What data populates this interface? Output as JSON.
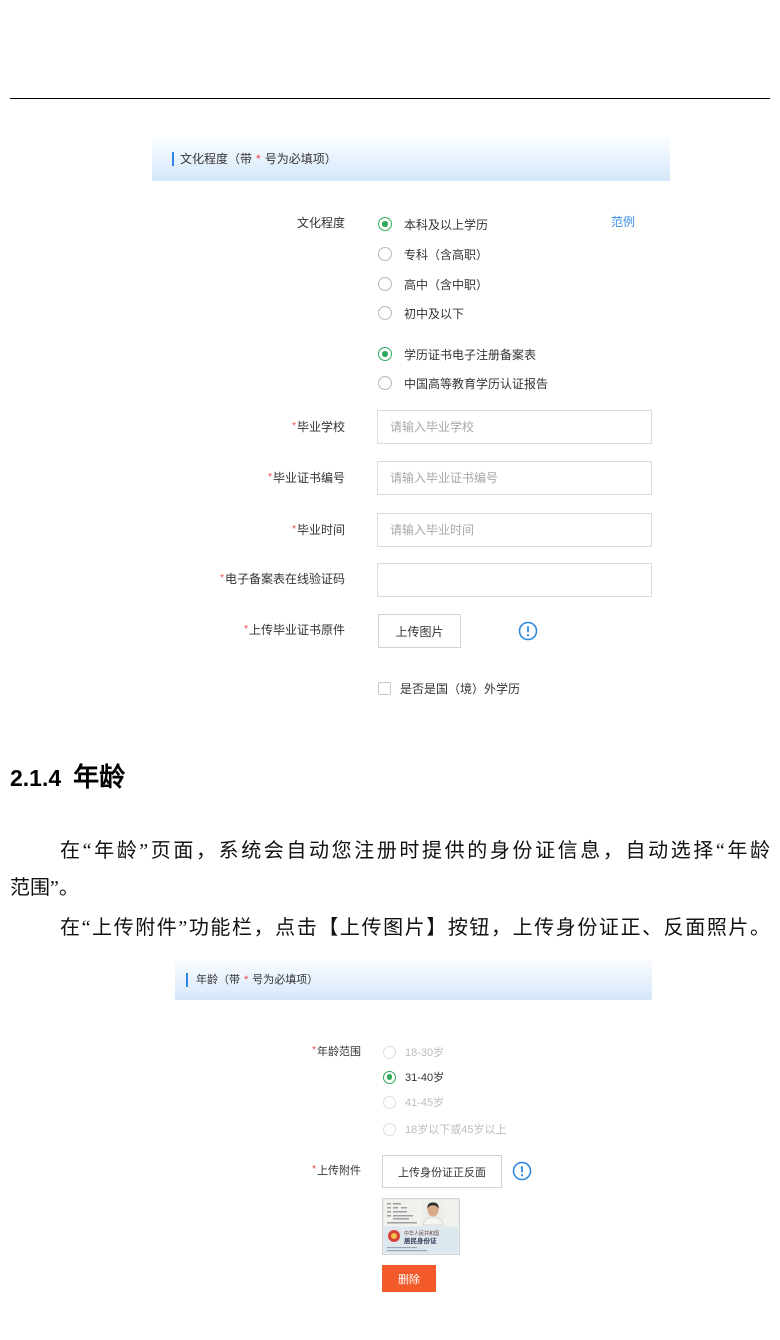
{
  "colors": {
    "accent": "#2f86e0",
    "selected": "#2eaa5c",
    "required": "#f04141",
    "link": "#3a8ee6",
    "danger_button": "#f25a2a",
    "header_gradient_top": "#fbfdff",
    "header_gradient_bottom": "#d5e7fa"
  },
  "icons": {
    "info": "info-circle-icon"
  },
  "education_form": {
    "header": {
      "title_prefix": "文化程度（带",
      "required_mark": "*",
      "title_suffix": "号为必填项）"
    },
    "required_mark": "*",
    "education_level": {
      "label": "文化程度",
      "example_link": "范例",
      "options": [
        {
          "label": "本科及以上学历",
          "selected": true
        },
        {
          "label": "专科（含高职）",
          "selected": false
        },
        {
          "label": "高中（含中职）",
          "selected": false
        },
        {
          "label": "初中及以下",
          "selected": false
        }
      ]
    },
    "certificate_type": {
      "options": [
        {
          "label": "学历证书电子注册备案表",
          "selected": true
        },
        {
          "label": "中国高等教育学历认证报告",
          "selected": false
        }
      ]
    },
    "graduation_school": {
      "label": "毕业学校",
      "placeholder": "请输入毕业学校"
    },
    "certificate_number": {
      "label": "毕业证书编号",
      "placeholder": "请输入毕业证书编号"
    },
    "graduation_date": {
      "label": "毕业时间",
      "placeholder": "请输入毕业时间"
    },
    "verification_code": {
      "label": "电子备案表在线验证码"
    },
    "certificate_upload": {
      "label": "上传毕业证书原件",
      "button": "上传图片"
    },
    "foreign_degree": {
      "label": "是否是国（境）外学历",
      "checked": false
    }
  },
  "document": {
    "section_number": "2.1.4",
    "section_title": "年龄",
    "paragraphs": [
      {
        "lines": [
          "在“年龄”页面，系统会自动您注册时提供的身份证信息，自动选择“年龄",
          "范围”。"
        ]
      },
      {
        "lines": [
          "在“上传附件”功能栏，点击【上传图片】按钮，上传身份证正、反面照片。"
        ]
      }
    ]
  },
  "age_form": {
    "header": {
      "title_prefix": "年龄（带",
      "required_mark": "*",
      "title_suffix": "号为必填项）"
    },
    "required_mark": "*",
    "age_range": {
      "label": "年龄范围",
      "options": [
        {
          "label": "18-30岁",
          "selected": false,
          "disabled": true
        },
        {
          "label": "31-40岁",
          "selected": true,
          "disabled": false
        },
        {
          "label": "41-45岁",
          "selected": false,
          "disabled": true
        },
        {
          "label": "18岁以下或45岁以上",
          "selected": false,
          "disabled": true
        }
      ]
    },
    "attachment": {
      "label": "上传附件",
      "button": "上传身份证正反面",
      "thumbnail": {
        "caption_line1": "中华人民共和国",
        "caption_line2": "居民身份证"
      },
      "delete_button": "删除"
    }
  }
}
